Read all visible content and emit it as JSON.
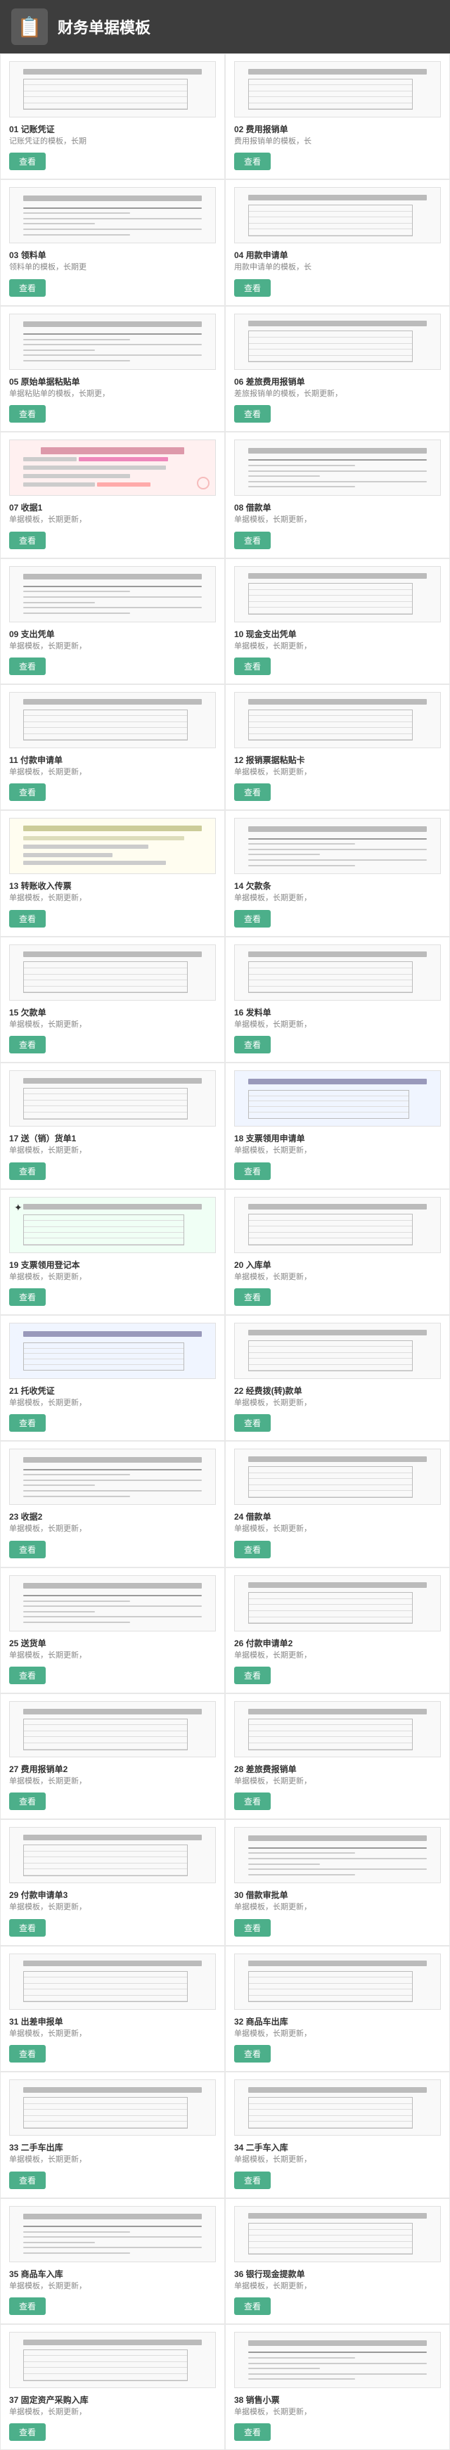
{
  "header": {
    "title": "财务单据模板",
    "icon": "📋"
  },
  "items": [
    {
      "id": "01",
      "name": "记账凭证",
      "desc": "记账凭证的模板，长期",
      "style": "grid"
    },
    {
      "id": "02",
      "name": "费用报销单",
      "desc": "费用报销单的模板，长",
      "style": "grid"
    },
    {
      "id": "03",
      "name": "领料单",
      "desc": "领料单的模板，长期更",
      "style": "lines"
    },
    {
      "id": "04",
      "name": "用款申请单",
      "desc": "用款申请单的模板，长",
      "style": "grid"
    },
    {
      "id": "05",
      "name": "原始单据粘贴单",
      "desc": "单据粘贴单的模板，长期更，",
      "style": "lines"
    },
    {
      "id": "06",
      "name": "差旅费用报销单",
      "desc": "差旅报销单的模板，长期更新，",
      "style": "grid"
    },
    {
      "id": "07",
      "name": "收据1",
      "desc": "单据模板，长期更新，",
      "style": "pink"
    },
    {
      "id": "08",
      "name": "借款单",
      "desc": "单据模板，长期更新，",
      "style": "lines"
    },
    {
      "id": "09",
      "name": "支出凭单",
      "desc": "单据模板，长期更新，",
      "style": "lines"
    },
    {
      "id": "10",
      "name": "现金支出凭单",
      "desc": "单据模板，长期更新，",
      "style": "grid"
    },
    {
      "id": "11",
      "name": "付款申请单",
      "desc": "单据模板，长期更新，",
      "style": "grid"
    },
    {
      "id": "12",
      "name": "报销票据粘贴卡",
      "desc": "单据模板，长期更新，",
      "style": "grid"
    },
    {
      "id": "13",
      "name": "转账收入传票",
      "desc": "单据模板，长期更新，",
      "style": "yellow"
    },
    {
      "id": "14",
      "name": "欠款条",
      "desc": "单据模板，长期更新，",
      "style": "lines"
    },
    {
      "id": "15",
      "name": "欠款单",
      "desc": "单据模板，长期更新，",
      "style": "grid"
    },
    {
      "id": "16",
      "name": "发料单",
      "desc": "单据模板，长期更新，",
      "style": "grid"
    },
    {
      "id": "17",
      "name": "送（销）货单1",
      "desc": "单据模板，长期更新，",
      "style": "grid"
    },
    {
      "id": "18",
      "name": "支票领用申请单",
      "desc": "单据模板，长期更新，",
      "style": "blue"
    },
    {
      "id": "19",
      "name": "支票领用登记本",
      "desc": "单据模板，长期更新，",
      "style": "star"
    },
    {
      "id": "20",
      "name": "入库单",
      "desc": "单据模板，长期更新，",
      "style": "grid"
    },
    {
      "id": "21",
      "name": "托收凭证",
      "desc": "单据模板，长期更新，",
      "style": "blue"
    },
    {
      "id": "22",
      "name": "经费拨(转)款单",
      "desc": "单据模板，长期更新，",
      "style": "grid"
    },
    {
      "id": "23",
      "name": "收据2",
      "desc": "单据模板，长期更新，",
      "style": "lines"
    },
    {
      "id": "24",
      "name": "借款单",
      "desc": "单据模板，长期更新，",
      "style": "grid"
    },
    {
      "id": "25",
      "name": "送货单",
      "desc": "单据模板，长期更新，",
      "style": "lines"
    },
    {
      "id": "26",
      "name": "付款申请单2",
      "desc": "单据模板，长期更新，",
      "style": "grid"
    },
    {
      "id": "27",
      "name": "费用报销单2",
      "desc": "单据模板，长期更新，",
      "style": "grid"
    },
    {
      "id": "28",
      "name": "差旅费报销单",
      "desc": "单据模板，长期更新，",
      "style": "grid"
    },
    {
      "id": "29",
      "name": "付款申请单3",
      "desc": "单据模板，长期更新，",
      "style": "grid"
    },
    {
      "id": "30",
      "name": "借款审批单",
      "desc": "单据模板，长期更新，",
      "style": "lines"
    },
    {
      "id": "31",
      "name": "出差申报单",
      "desc": "单据模板，长期更新，",
      "style": "grid"
    },
    {
      "id": "32",
      "name": "商品车出库",
      "desc": "单据模板，长期更新，",
      "style": "grid"
    },
    {
      "id": "33",
      "name": "二手车出库",
      "desc": "单据模板，长期更新，",
      "style": "grid"
    },
    {
      "id": "34",
      "name": "二手车入库",
      "desc": "单据模板，长期更新，",
      "style": "grid"
    },
    {
      "id": "35",
      "name": "商品车入库",
      "desc": "单据模板，长期更新，",
      "style": "lines"
    },
    {
      "id": "36",
      "name": "银行现金提款单",
      "desc": "单据模板，长期更新，",
      "style": "grid"
    },
    {
      "id": "37",
      "name": "固定资产采购入库",
      "desc": "单据模板，长期更新，",
      "style": "grid"
    },
    {
      "id": "38",
      "name": "销售小票",
      "desc": "单据模板，长期更新，",
      "style": "lines"
    }
  ],
  "btn_label": "查看"
}
